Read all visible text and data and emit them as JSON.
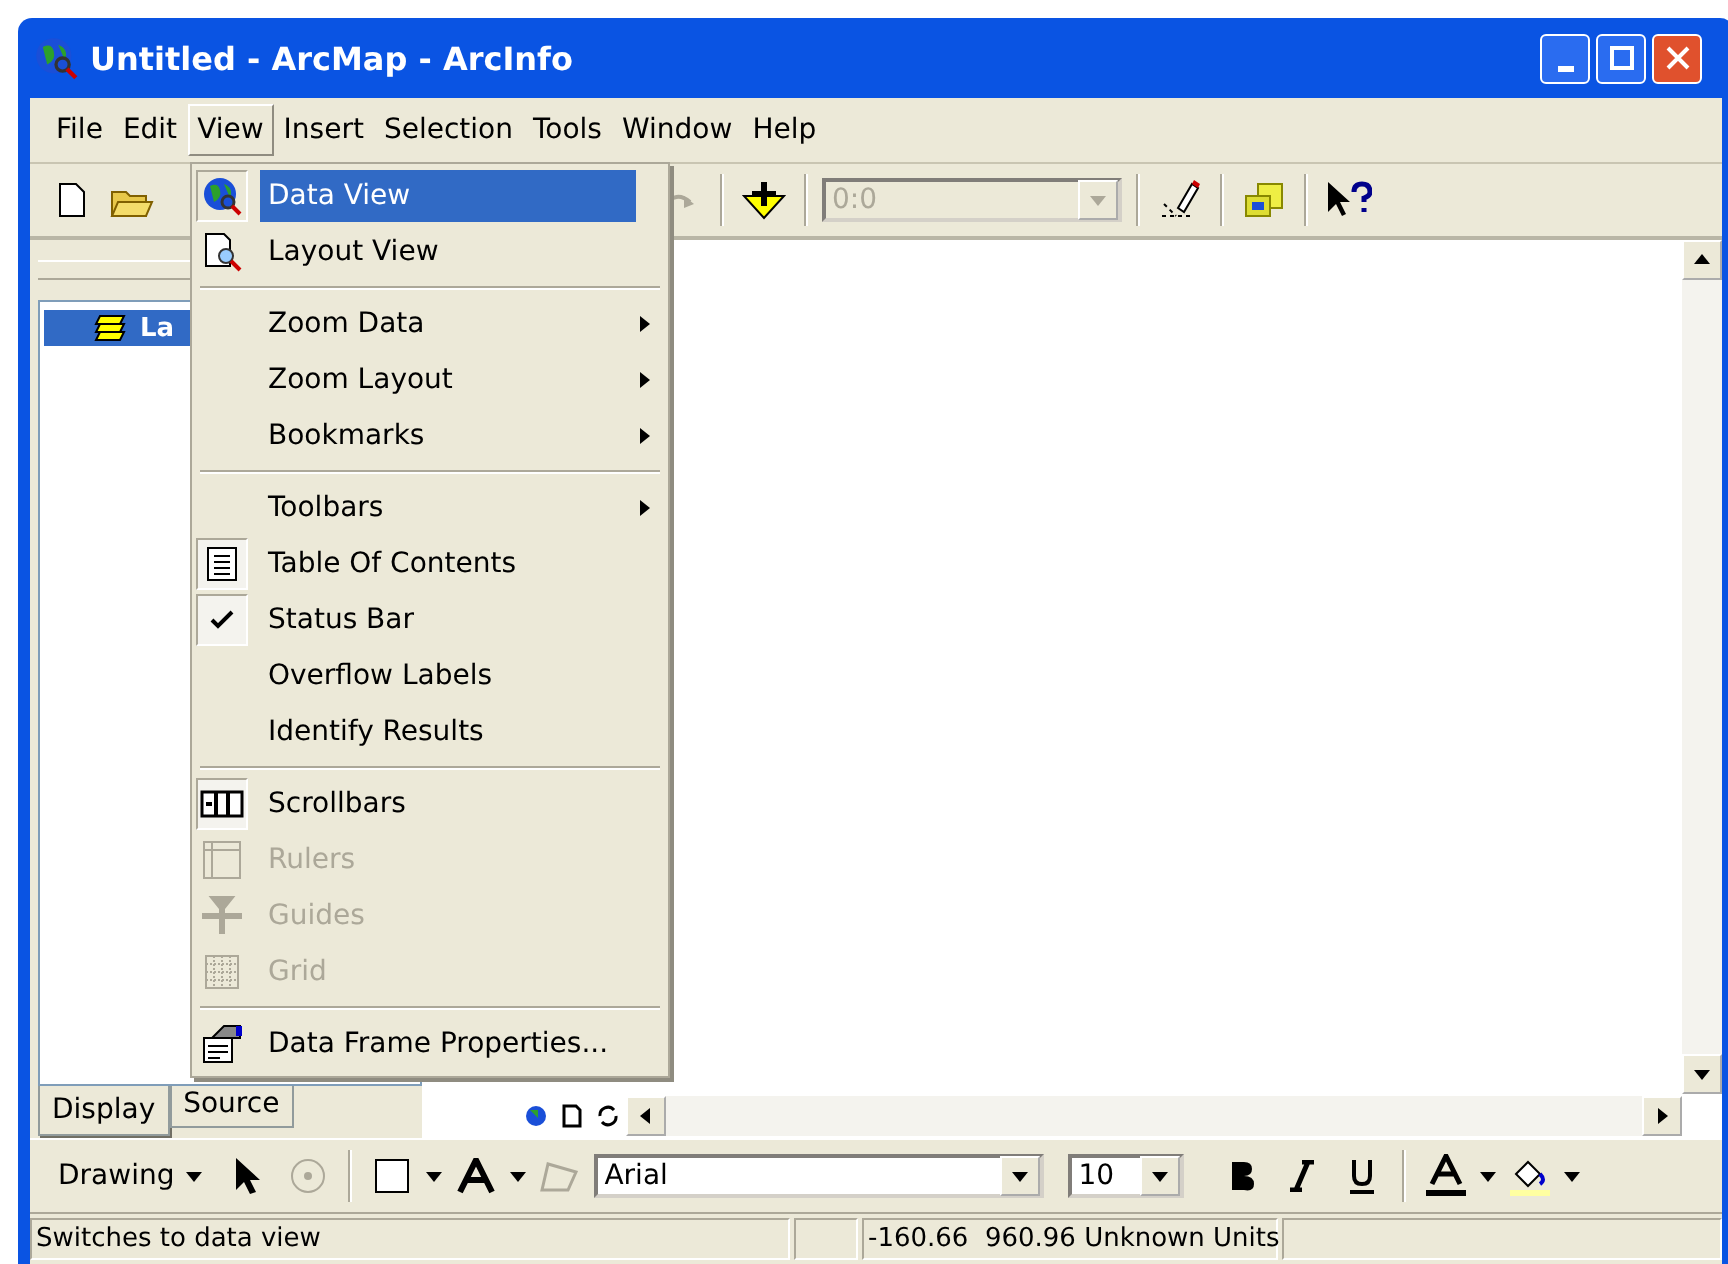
{
  "window": {
    "title": "Untitled - ArcMap - ArcInfo"
  },
  "menu_bar": [
    {
      "label": "File",
      "selected": false
    },
    {
      "label": "Edit",
      "selected": false
    },
    {
      "label": "View",
      "selected": true
    },
    {
      "label": "Insert",
      "selected": false
    },
    {
      "label": "Selection",
      "selected": false
    },
    {
      "label": "Tools",
      "selected": false
    },
    {
      "label": "Window",
      "selected": false
    },
    {
      "label": "Help",
      "selected": false
    }
  ],
  "view_menu": [
    {
      "kind": "item",
      "label": "Data View",
      "selected": true,
      "checked": false,
      "disabled": false
    },
    {
      "kind": "item",
      "label": "Layout View",
      "selected": false,
      "checked": false,
      "disabled": false
    },
    {
      "kind": "separator"
    },
    {
      "kind": "submenu",
      "label": "Zoom Data",
      "selected": false,
      "checked": false,
      "disabled": false
    },
    {
      "kind": "submenu",
      "label": "Zoom Layout",
      "selected": false,
      "checked": false,
      "disabled": false
    },
    {
      "kind": "submenu",
      "label": "Bookmarks",
      "selected": false,
      "checked": false,
      "disabled": false
    },
    {
      "kind": "separator"
    },
    {
      "kind": "submenu",
      "label": "Toolbars",
      "selected": false,
      "checked": false,
      "disabled": false
    },
    {
      "kind": "item",
      "label": "Table Of Contents",
      "selected": false,
      "checked": true,
      "disabled": false
    },
    {
      "kind": "item",
      "label": "Status Bar",
      "selected": false,
      "checked": true,
      "disabled": false
    },
    {
      "kind": "item",
      "label": "Overflow Labels",
      "selected": false,
      "checked": false,
      "disabled": false
    },
    {
      "kind": "item",
      "label": "Identify Results",
      "selected": false,
      "checked": false,
      "disabled": false
    },
    {
      "kind": "separator"
    },
    {
      "kind": "item",
      "label": "Scrollbars",
      "selected": false,
      "checked": true,
      "disabled": false
    },
    {
      "kind": "item",
      "label": "Rulers",
      "selected": false,
      "checked": false,
      "disabled": true
    },
    {
      "kind": "item",
      "label": "Guides",
      "selected": false,
      "checked": false,
      "disabled": true
    },
    {
      "kind": "item",
      "label": "Grid",
      "selected": false,
      "checked": false,
      "disabled": true
    },
    {
      "kind": "separator"
    },
    {
      "kind": "item",
      "label": "Data Frame Properties...",
      "selected": false,
      "checked": false,
      "disabled": false
    }
  ],
  "toolbar": {
    "scale_box": {
      "value": "0:0",
      "disabled": true
    }
  },
  "toc": {
    "items": [
      {
        "label": "La",
        "selected": true
      }
    ],
    "tabs": [
      {
        "label": "Display",
        "selected": true
      },
      {
        "label": "Source",
        "selected": false
      }
    ]
  },
  "drawing_toolbar": {
    "drawing_menu": "Drawing",
    "font": "Arial",
    "font_size": "10"
  },
  "status_bar": {
    "message": "Switches to data view",
    "coordinates": "-160.66  960.96 Unknown Units"
  }
}
